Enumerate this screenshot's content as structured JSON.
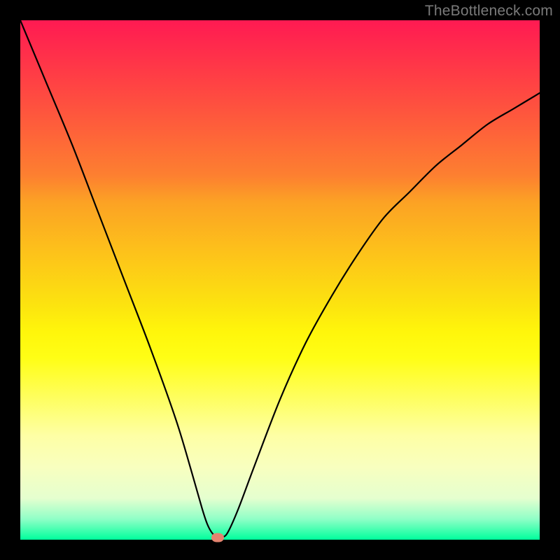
{
  "watermark": "TheBottleneck.com",
  "chart_data": {
    "type": "line",
    "title": "",
    "xlabel": "",
    "ylabel": "",
    "xlim": [
      0,
      100
    ],
    "ylim": [
      0,
      100
    ],
    "series": [
      {
        "name": "curve",
        "x": [
          0,
          5,
          10,
          15,
          20,
          25,
          30,
          33,
          35,
          36,
          37,
          38,
          39,
          40,
          42,
          45,
          50,
          55,
          60,
          65,
          70,
          75,
          80,
          85,
          90,
          95,
          100
        ],
        "values": [
          100,
          88,
          76,
          63,
          50,
          37,
          23,
          13,
          6,
          3,
          1.2,
          0.5,
          0.5,
          1.5,
          6,
          14,
          27,
          38,
          47,
          55,
          62,
          67,
          72,
          76,
          80,
          83,
          86
        ]
      }
    ],
    "marker": {
      "x": 38,
      "y": 0.4,
      "color": "#e4836f"
    },
    "gradient": {
      "top": "#ff1a52",
      "bottom": "#00ff9c"
    }
  }
}
